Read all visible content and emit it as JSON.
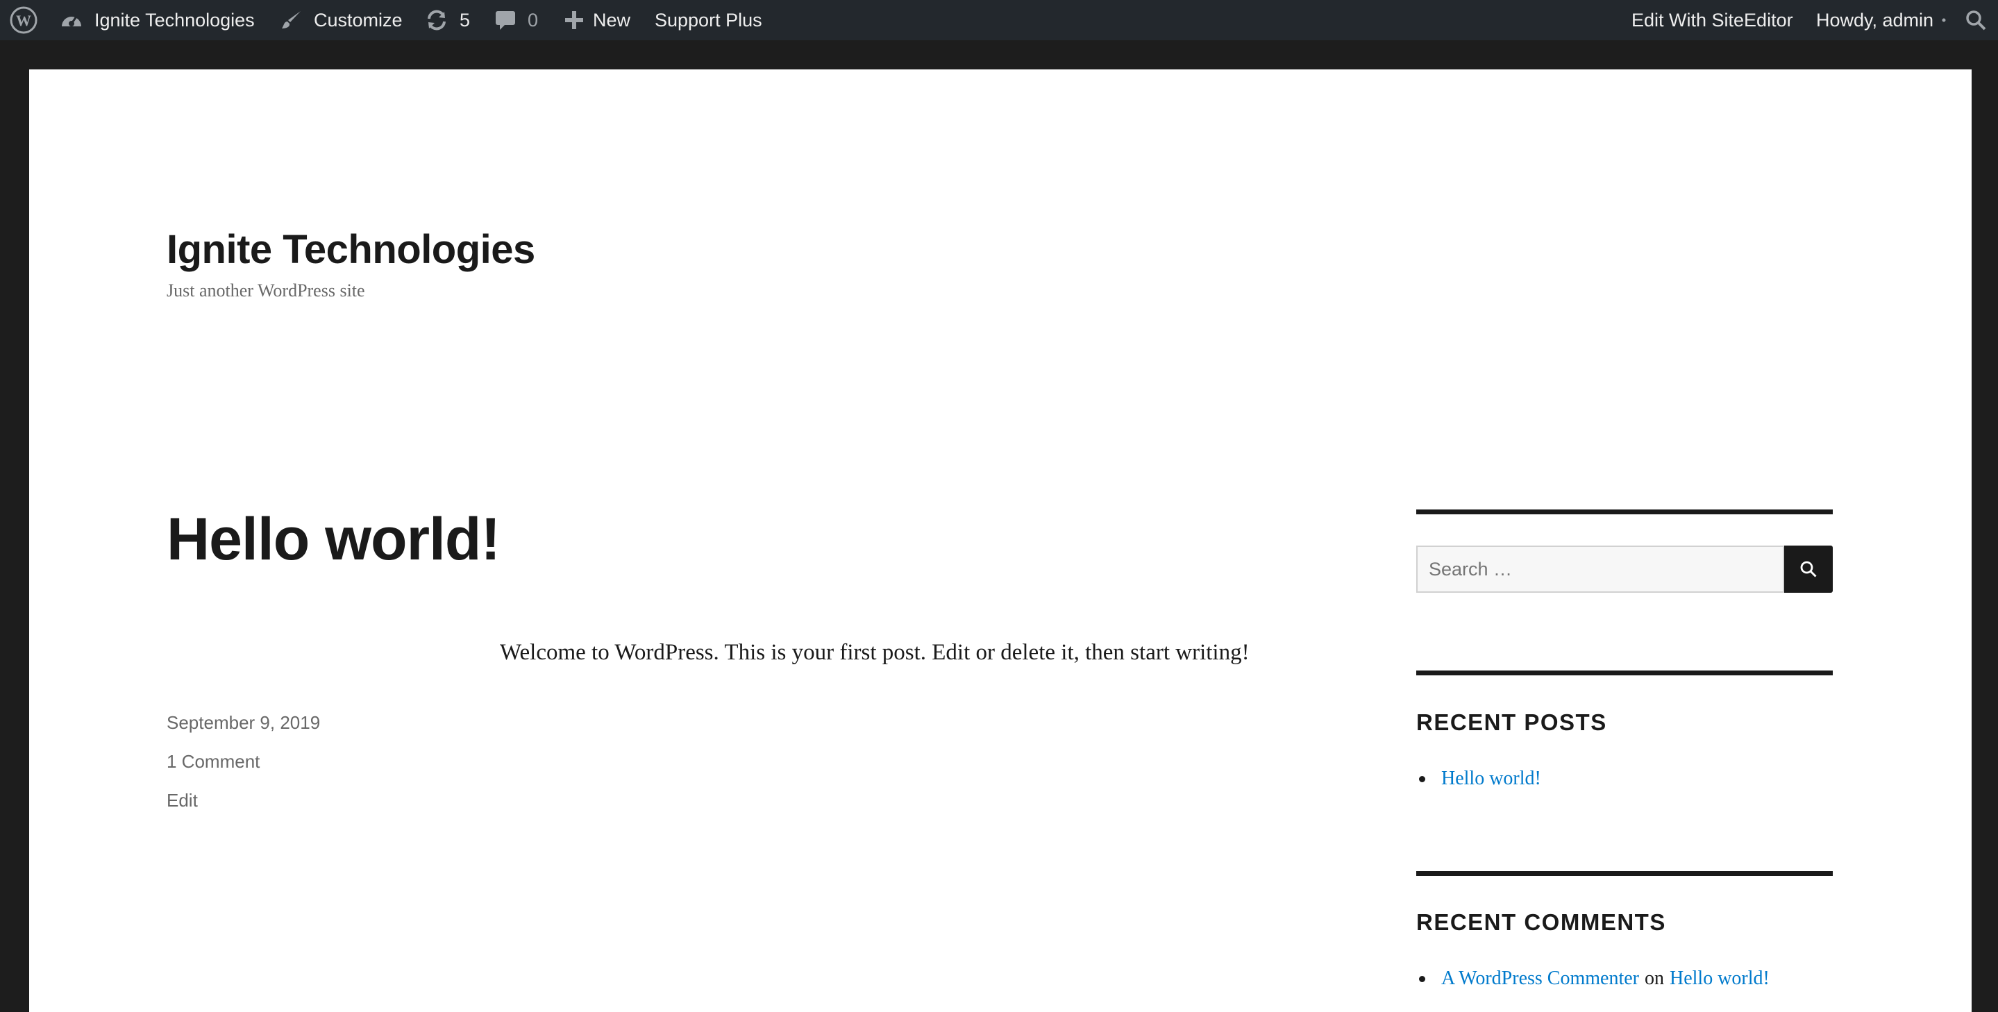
{
  "admin_bar": {
    "site_name": "Ignite Technologies",
    "customize": "Customize",
    "updates_count": "5",
    "comments_count": "0",
    "new_label": "New",
    "support_plus": "Support Plus",
    "edit_site_editor": "Edit With SiteEditor",
    "howdy": "Howdy, admin"
  },
  "site": {
    "title": "Ignite Technologies",
    "description": "Just another WordPress site"
  },
  "post": {
    "title": "Hello world!",
    "date": "September 9, 2019",
    "comments": "1 Comment",
    "edit": "Edit",
    "content": "Welcome to WordPress. This is your first post. Edit or delete it, then start writing!"
  },
  "sidebar": {
    "search_placeholder": "Search …",
    "recent_posts_title": "RECENT POSTS",
    "recent_posts": [
      "Hello world!"
    ],
    "recent_comments_title": "RECENT COMMENTS",
    "recent_comment": {
      "author": "A WordPress Commenter",
      "on": "on",
      "post": "Hello world!"
    }
  },
  "colors": {
    "admin_bar_bg": "#23282d",
    "link": "#007acc",
    "text": "#1a1a1a"
  }
}
